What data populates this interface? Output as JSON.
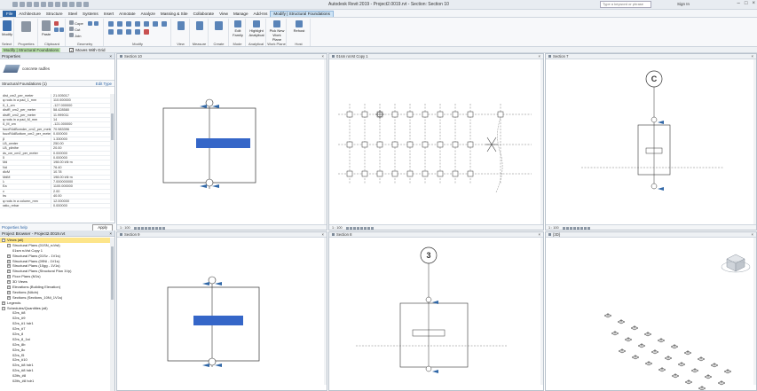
{
  "titlebar": {
    "title": "Autodesk Revit 2019 - Project2.0019.rvt - Section: Section 10",
    "search_placeholder": "Type a keyword or phrase",
    "sign_in": "Sign In"
  },
  "tabs": [
    {
      "label": "File"
    },
    {
      "label": "Architecture"
    },
    {
      "label": "Structure"
    },
    {
      "label": "Steel"
    },
    {
      "label": "Systems"
    },
    {
      "label": "Insert"
    },
    {
      "label": "Annotate"
    },
    {
      "label": "Analyze"
    },
    {
      "label": "Massing & Site"
    },
    {
      "label": "Collaborate"
    },
    {
      "label": "View"
    },
    {
      "label": "Manage"
    },
    {
      "label": "Add-Ins"
    },
    {
      "label": "Modify | Structural Foundations"
    }
  ],
  "ribbon": {
    "groups": {
      "select": "Select",
      "properties": "Properties",
      "clipboard": "Clipboard",
      "geometry": "Geometry",
      "modify": "Modify",
      "view": "View",
      "measure": "Measure",
      "create": "Create",
      "mode": "Mode",
      "analytical": "Analytical",
      "work_plane": "Work Plane",
      "host": "Host"
    },
    "buttons": {
      "modify": "Modify",
      "paste": "Paste",
      "cope": "Cope",
      "cut": "Cut",
      "join": "Join",
      "edit_family": "Edit Family",
      "highlight_analytical": "Highlight Analytical",
      "pick_new_work_plane": "Pick New Work Plane",
      "rehost": "Rehost"
    }
  },
  "options_bar": {
    "context": "Modify | Structural Foundations",
    "move_with_grid": "Moves With Grid"
  },
  "properties": {
    "title": "Properties",
    "type_name": "concrete radfes",
    "selector": "Structural Foundations (1)",
    "edit_type": "Edit Type",
    "rows": [
      {
        "k": "dist_cm2_per_meter",
        "v": "21.005017"
      },
      {
        "k": "φ rods in a pad_1_mm",
        "v": "110.000000"
      },
      {
        "k": "ß_1_cm",
        "v": "-127.000000"
      },
      {
        "k": "distR_cm2_per_meter",
        "v": "58.428580"
      },
      {
        "k": "distR_cm2_per_meter",
        "v": "11.999011"
      },
      {
        "k": "φ rods in a pad_M_mm",
        "v": "14"
      },
      {
        "k": "ß_M_cm",
        "v": "-121.000000"
      },
      {
        "k": "fouxR4dBomder_cm2_per_meter",
        "v": "70.983396"
      },
      {
        "k": "fouxR4dBottom_cm2_per_meter",
        "v": "0.000000"
      },
      {
        "k": "β",
        "v": "1.330000"
      },
      {
        "k": "LB_center",
        "v": "250.00"
      },
      {
        "k": "LB_plinthe",
        "v": "20.00"
      },
      {
        "k": "ds_cm_cm2_per_meter",
        "v": "0.000000"
      },
      {
        "k": "δ",
        "v": "0.000000"
      },
      {
        "k": "Md",
        "v": "198.00 kN·m"
      },
      {
        "k": "Nd",
        "v": "76.40"
      },
      {
        "k": "dlcM",
        "v": "10.78"
      },
      {
        "k": "MdM",
        "v": "198.00 kN·m"
      },
      {
        "k": "λ",
        "v": "7.000000000"
      },
      {
        "k": "Ea",
        "v": "1100.000000"
      },
      {
        "k": "v",
        "v": "2.00"
      },
      {
        "k": "hs",
        "v": "40.00"
      },
      {
        "k": "φ rods in a column_mm",
        "v": "12.000000"
      },
      {
        "k": "ratio_rebar",
        "v": "0.000000"
      }
    ],
    "help_link": "Properties help",
    "apply": "Apply"
  },
  "browser": {
    "title": "Project Browser - Project2.0019.rvt",
    "items": [
      {
        "label": "Views (all)",
        "level": 0,
        "tog": "−"
      },
      {
        "label": "Structural Plans (01SN_ruVst)",
        "level": 1,
        "tog": "−"
      },
      {
        "label": "01sm ruVst Copy 1",
        "level": 2,
        "tog": ""
      },
      {
        "label": "Structural Plans (01Sv ‐ 1V1s)",
        "level": 1,
        "tog": "+"
      },
      {
        "label": "Structural Plans (09Ni ‐ 1V1s)",
        "level": 1,
        "tog": "+"
      },
      {
        "label": "Structural Plans (10gg ‐ 1V1s)",
        "level": 1,
        "tog": "+"
      },
      {
        "label": "Structural Plans (Structural Plan 1Vp)",
        "level": 1,
        "tog": "+"
      },
      {
        "label": "Floor Plans (M1s)",
        "level": 1,
        "tog": "+"
      },
      {
        "label": "3D Views",
        "level": 1,
        "tog": "+"
      },
      {
        "label": "Elevations (Building Elevation)",
        "level": 1,
        "tog": "+"
      },
      {
        "label": "Sections (NAdn)",
        "level": 1,
        "tog": "+"
      },
      {
        "label": "Sections (Sections_10Ni_1V1s)",
        "level": 1,
        "tog": "+"
      },
      {
        "label": "Legends",
        "level": 0,
        "tog": "+"
      },
      {
        "label": "Schedules/Quantities (all)",
        "level": 0,
        "tog": "−"
      },
      {
        "label": "02rs_#8",
        "level": 2,
        "tog": ""
      },
      {
        "label": "02rs_#9",
        "level": 2,
        "tog": ""
      },
      {
        "label": "02rs_#1 hdr1",
        "level": 2,
        "tog": ""
      },
      {
        "label": "02rs_#7",
        "level": 2,
        "tog": ""
      },
      {
        "label": "02rs_8",
        "level": 2,
        "tog": ""
      },
      {
        "label": "02rs_8_1st",
        "level": 2,
        "tog": ""
      },
      {
        "label": "02rs_8b",
        "level": 2,
        "tog": ""
      },
      {
        "label": "02rs_8c",
        "level": 2,
        "tog": ""
      },
      {
        "label": "02rs_f5",
        "level": 2,
        "tog": ""
      },
      {
        "label": "02rs_#10",
        "level": 2,
        "tog": ""
      },
      {
        "label": "02rs_#8 hdr1",
        "level": 2,
        "tog": ""
      },
      {
        "label": "02rs_#8 hdr1",
        "level": 2,
        "tog": ""
      },
      {
        "label": "02lfs_#8",
        "level": 2,
        "tog": ""
      },
      {
        "label": "02lfs_#8 hdr1",
        "level": 2,
        "tog": ""
      }
    ]
  },
  "views": {
    "v1": {
      "title": "Section 10",
      "scale": "1 : 100"
    },
    "v2": {
      "title": "01sm ruVst Copy 1",
      "scale": "1 : 100"
    },
    "v3": {
      "title": "Section 7",
      "scale": "1 : 100",
      "grid_bubble": "C"
    },
    "v4": {
      "title": "Section 9",
      "scale": "1 : 100"
    },
    "v5": {
      "title": "Section 8",
      "scale": "1 : 100",
      "grid_bubble": "3"
    },
    "v6": {
      "title": "{3D}",
      "scale": "1 : 100"
    }
  },
  "colors": {
    "ribbon_active_tab": "#cde3f5",
    "footing_fill": "#3566c8",
    "selection_blue": "#2f66a6"
  }
}
